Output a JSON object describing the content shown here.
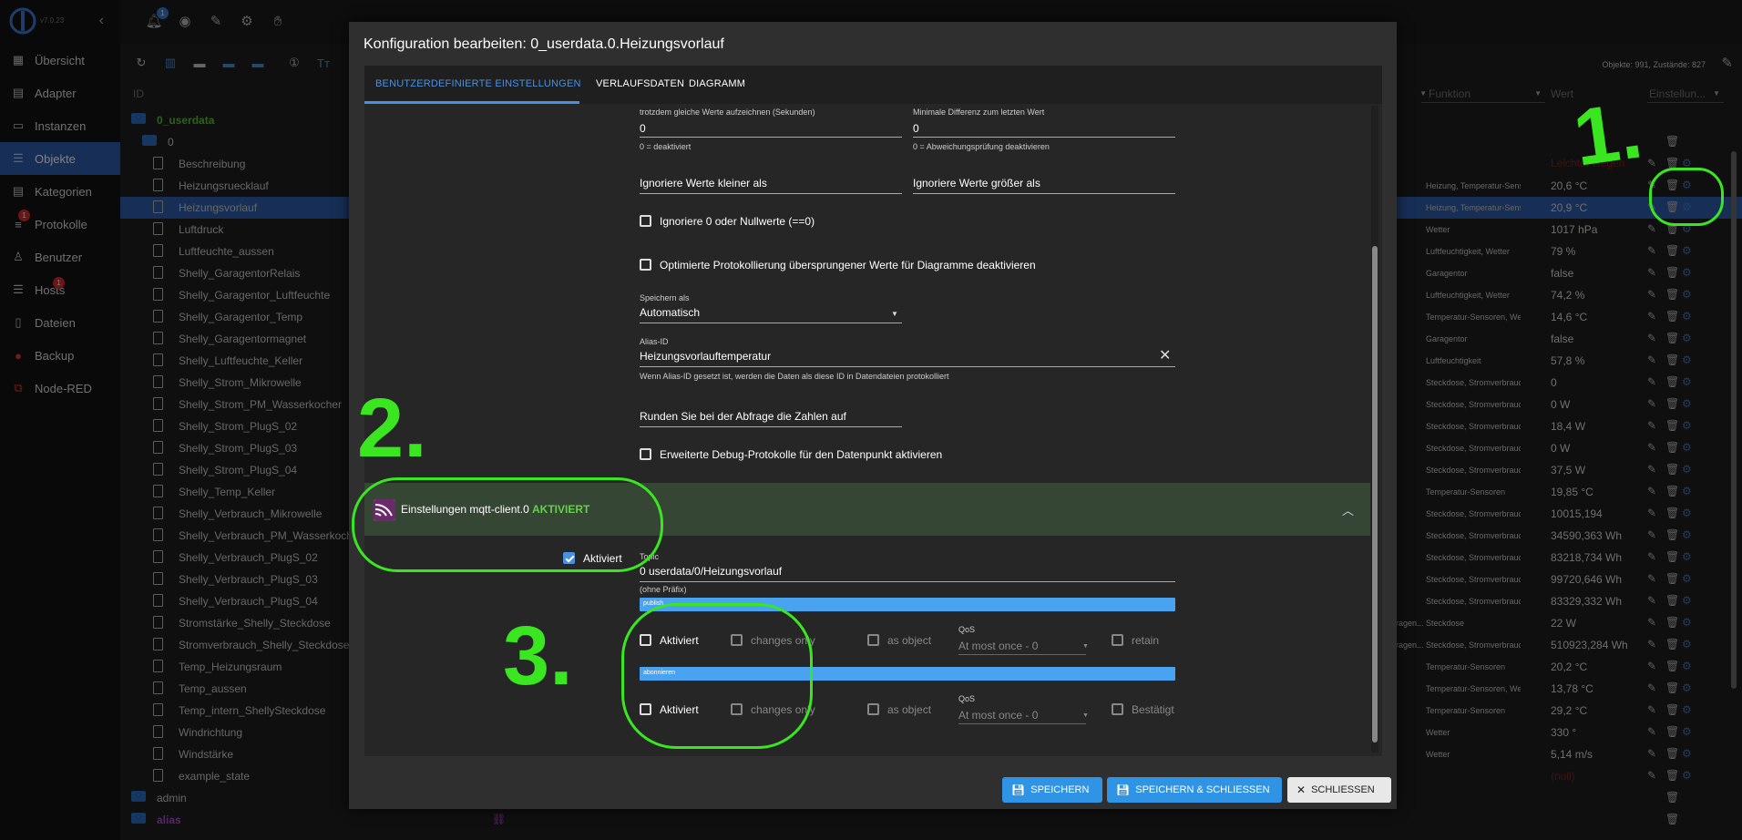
{
  "sidebar": {
    "version": "v7.0.23",
    "items": [
      {
        "label": "Übersicht",
        "icon": "grid-icon"
      },
      {
        "label": "Adapter",
        "icon": "store-icon"
      },
      {
        "label": "Instanzen",
        "icon": "monitor-icon"
      },
      {
        "label": "Objekte",
        "icon": "list-icon"
      },
      {
        "label": "Kategorien",
        "icon": "tags-icon"
      },
      {
        "label": "Protokolle",
        "icon": "lines-icon",
        "badge": "1"
      },
      {
        "label": "Benutzer",
        "icon": "user-icon"
      },
      {
        "label": "Hosts",
        "icon": "hosts-icon",
        "badge": "1"
      },
      {
        "label": "Dateien",
        "icon": "file-icon"
      },
      {
        "label": "Backup",
        "icon": "backup-icon"
      },
      {
        "label": "Node-RED",
        "icon": "nodered-icon"
      }
    ]
  },
  "topbar": {
    "bell_badge": "1"
  },
  "browser": {
    "count": "Objekte: 991, Zustände: 827",
    "headers": {
      "id": "ID",
      "funktion": "Funktion",
      "wert": "Wert",
      "einstellungen": "Einstellun..."
    },
    "partial_value": "Leichter Regen",
    "rows": [
      {
        "name": "0_userdata",
        "type": "folder",
        "func": "",
        "value": ""
      },
      {
        "name": "0",
        "type": "folder",
        "func": "",
        "value": ""
      },
      {
        "name": "Beschreibung",
        "type": "file",
        "func": "",
        "value": ""
      },
      {
        "name": "Heizungsruecklauf",
        "type": "file",
        "func": "Heizung, Temperatur-Sensoren",
        "value": "20,6 °C"
      },
      {
        "name": "Heizungsvorlauf",
        "type": "file",
        "func": "Heizung, Temperatur-Sensoren",
        "value": "20,9 °C"
      },
      {
        "name": "Luftdruck",
        "type": "file",
        "func": "Wetter",
        "value": "1017 hPa"
      },
      {
        "name": "Luftfeuchte_aussen",
        "type": "file",
        "func": "Luftfeuchtigkeit, Wetter",
        "value": "79 %"
      },
      {
        "name": "Shelly_GaragentorRelais",
        "type": "file",
        "func": "Garagentor",
        "value": "false"
      },
      {
        "name": "Shelly_Garagentor_Luftfeuchte",
        "type": "file",
        "func": "Luftfeuchtigkeit, Wetter",
        "value": "74,2 %"
      },
      {
        "name": "Shelly_Garagentor_Temp",
        "type": "file",
        "func": "Temperatur-Sensoren, Wetter",
        "value": "14,6 °C"
      },
      {
        "name": "Shelly_Garagentormagnet",
        "type": "file",
        "func": "Garagentor",
        "value": "false"
      },
      {
        "name": "Shelly_Luftfeuchte_Keller",
        "type": "file",
        "func": "Luftfeuchtigkeit",
        "value": "57,8 %"
      },
      {
        "name": "Shelly_Strom_Mikrowelle",
        "type": "file",
        "func": "Steckdose, Stromverbrauch",
        "value": "0"
      },
      {
        "name": "Shelly_Strom_PM_Wasserkocher",
        "type": "file",
        "func": "Steckdose, Stromverbrauch",
        "value": "0 W"
      },
      {
        "name": "Shelly_Strom_PlugS_02",
        "type": "file",
        "func": "Steckdose, Stromverbrauch",
        "value": "18,4 W"
      },
      {
        "name": "Shelly_Strom_PlugS_03",
        "type": "file",
        "func": "Steckdose, Stromverbrauch",
        "value": "0 W"
      },
      {
        "name": "Shelly_Strom_PlugS_04",
        "type": "file",
        "func": "Steckdose, Stromverbrauch",
        "value": "37,5 W"
      },
      {
        "name": "Shelly_Temp_Keller",
        "type": "file",
        "func": "Temperatur-Sensoren",
        "value": "19,85 °C"
      },
      {
        "name": "Shelly_Verbrauch_Mikrowelle",
        "type": "file",
        "func": "Steckdose, Stromverbrauch",
        "value": "10015,194"
      },
      {
        "name": "Shelly_Verbrauch_PM_Wasserkocher",
        "type": "file",
        "func": "Steckdose, Stromverbrauch",
        "value": "34590,363 Wh"
      },
      {
        "name": "Shelly_Verbrauch_PlugS_02",
        "type": "file",
        "func": "Steckdose, Stromverbrauch",
        "value": "83218,734 Wh"
      },
      {
        "name": "Shelly_Verbrauch_PlugS_03",
        "type": "file",
        "func": "Steckdose, Stromverbrauch",
        "value": "99720,646 Wh"
      },
      {
        "name": "Shelly_Verbrauch_PlugS_04",
        "type": "file",
        "func": "Steckdose, Stromverbrauch",
        "value": "83329,332 Wh"
      },
      {
        "name": "Stromstärke_Shelly_Steckdose",
        "type": "file",
        "func": "Steckdose",
        "func_prefix": "ragen...",
        "value": "22 W"
      },
      {
        "name": "Stromverbrauch_Shelly_Steckdose",
        "type": "file",
        "func": "Steckdose, Stromverbrauch",
        "func_prefix": "ragen...",
        "value": "510923,284 Wh"
      },
      {
        "name": "Temp_Heizungsraum",
        "type": "file",
        "func": "Temperatur-Sensoren",
        "value": "20,2 °C"
      },
      {
        "name": "Temp_aussen",
        "type": "file",
        "func": "Temperatur-Sensoren, Wetter",
        "value": "13,78 °C"
      },
      {
        "name": "Temp_intern_ShellySteckdose",
        "type": "file",
        "func": "Temperatur-Sensoren",
        "value": "29,2 °C"
      },
      {
        "name": "Windrichtung",
        "type": "file",
        "func": "Wetter",
        "value": "330 °"
      },
      {
        "name": "Windstärke",
        "type": "file",
        "func": "Wetter",
        "value": "5,14 m/s"
      },
      {
        "name": "example_state",
        "type": "file",
        "func": "",
        "value": "(null)"
      },
      {
        "name": "admin",
        "type": "folder",
        "func": "",
        "value": ""
      },
      {
        "name": "alias",
        "type": "folder",
        "func": "",
        "value": ""
      }
    ]
  },
  "dialog": {
    "title": "Konfiguration bearbeiten: 0_userdata.0.Heizungsvorlauf",
    "tabs": [
      "BENUTZERDEFINIERTE EINSTELLUNGEN",
      "VERLAUFSDATEN",
      "DIAGRAMM"
    ],
    "fields": {
      "same_values_label": "trotzdem gleiche Werte aufzeichnen (Sekunden)",
      "same_values_value": "0",
      "same_values_help": "0 = deaktiviert",
      "min_diff_label": "Minimale Differenz zum letzten Wert",
      "min_diff_value": "0",
      "min_diff_help": "0 = Abweichungsprüfung deaktivieren",
      "ignore_smaller": "Ignoriere Werte kleiner als",
      "ignore_bigger": "Ignoriere Werte größer als",
      "ignore_zero": "Ignoriere 0 oder Nullwerte (==0)",
      "optimized_log": "Optimierte Protokollierung übersprungener Werte für Diagramme deaktivieren",
      "store_as_label": "Speichern als",
      "store_as_value": "Automatisch",
      "alias_label": "Alias-ID",
      "alias_value": "Heizungsvorlauftemperatur",
      "alias_help": "Wenn Alias-ID gesetzt ist, werden die Daten als diese ID in Datendateien protokolliert",
      "round": "Runden Sie bei der Abfrage die Zahlen auf",
      "debug": "Erweiterte Debug-Protokolle für den Datenpunkt aktivieren"
    },
    "mqtt": {
      "title": "Einstellungen mqtt-client.0",
      "status": "AKTIVIERT",
      "enabled_label": "Aktiviert",
      "topic_label": "Topic",
      "topic_value": "0 userdata/0/Heizungsvorlauf",
      "topic_help": "(ohne Präfix)",
      "publish_bar": "publish",
      "subscribe_bar": "abonnieren",
      "pub": {
        "enabled": "Aktiviert",
        "changes": "changes only",
        "object": "as object",
        "qos_label": "QoS",
        "qos_value": "At most once - 0",
        "retain": "retain"
      },
      "sub": {
        "enabled": "Aktiviert",
        "changes": "changes only",
        "object": "as object",
        "qos_label": "QoS",
        "qos_value": "At most once - 0",
        "confirm": "Bestätigt"
      }
    },
    "buttons": {
      "save": "SPEICHERN",
      "save_close": "SPEICHERN & SCHLIESSEN",
      "close": "SCHLIESSEN"
    }
  },
  "annotations": {
    "one": "1.",
    "two": "2.",
    "three": "3."
  },
  "colors": {
    "accent": "#4a90e2",
    "annotation": "#39e620",
    "mqtt_status": "#63d04a"
  }
}
